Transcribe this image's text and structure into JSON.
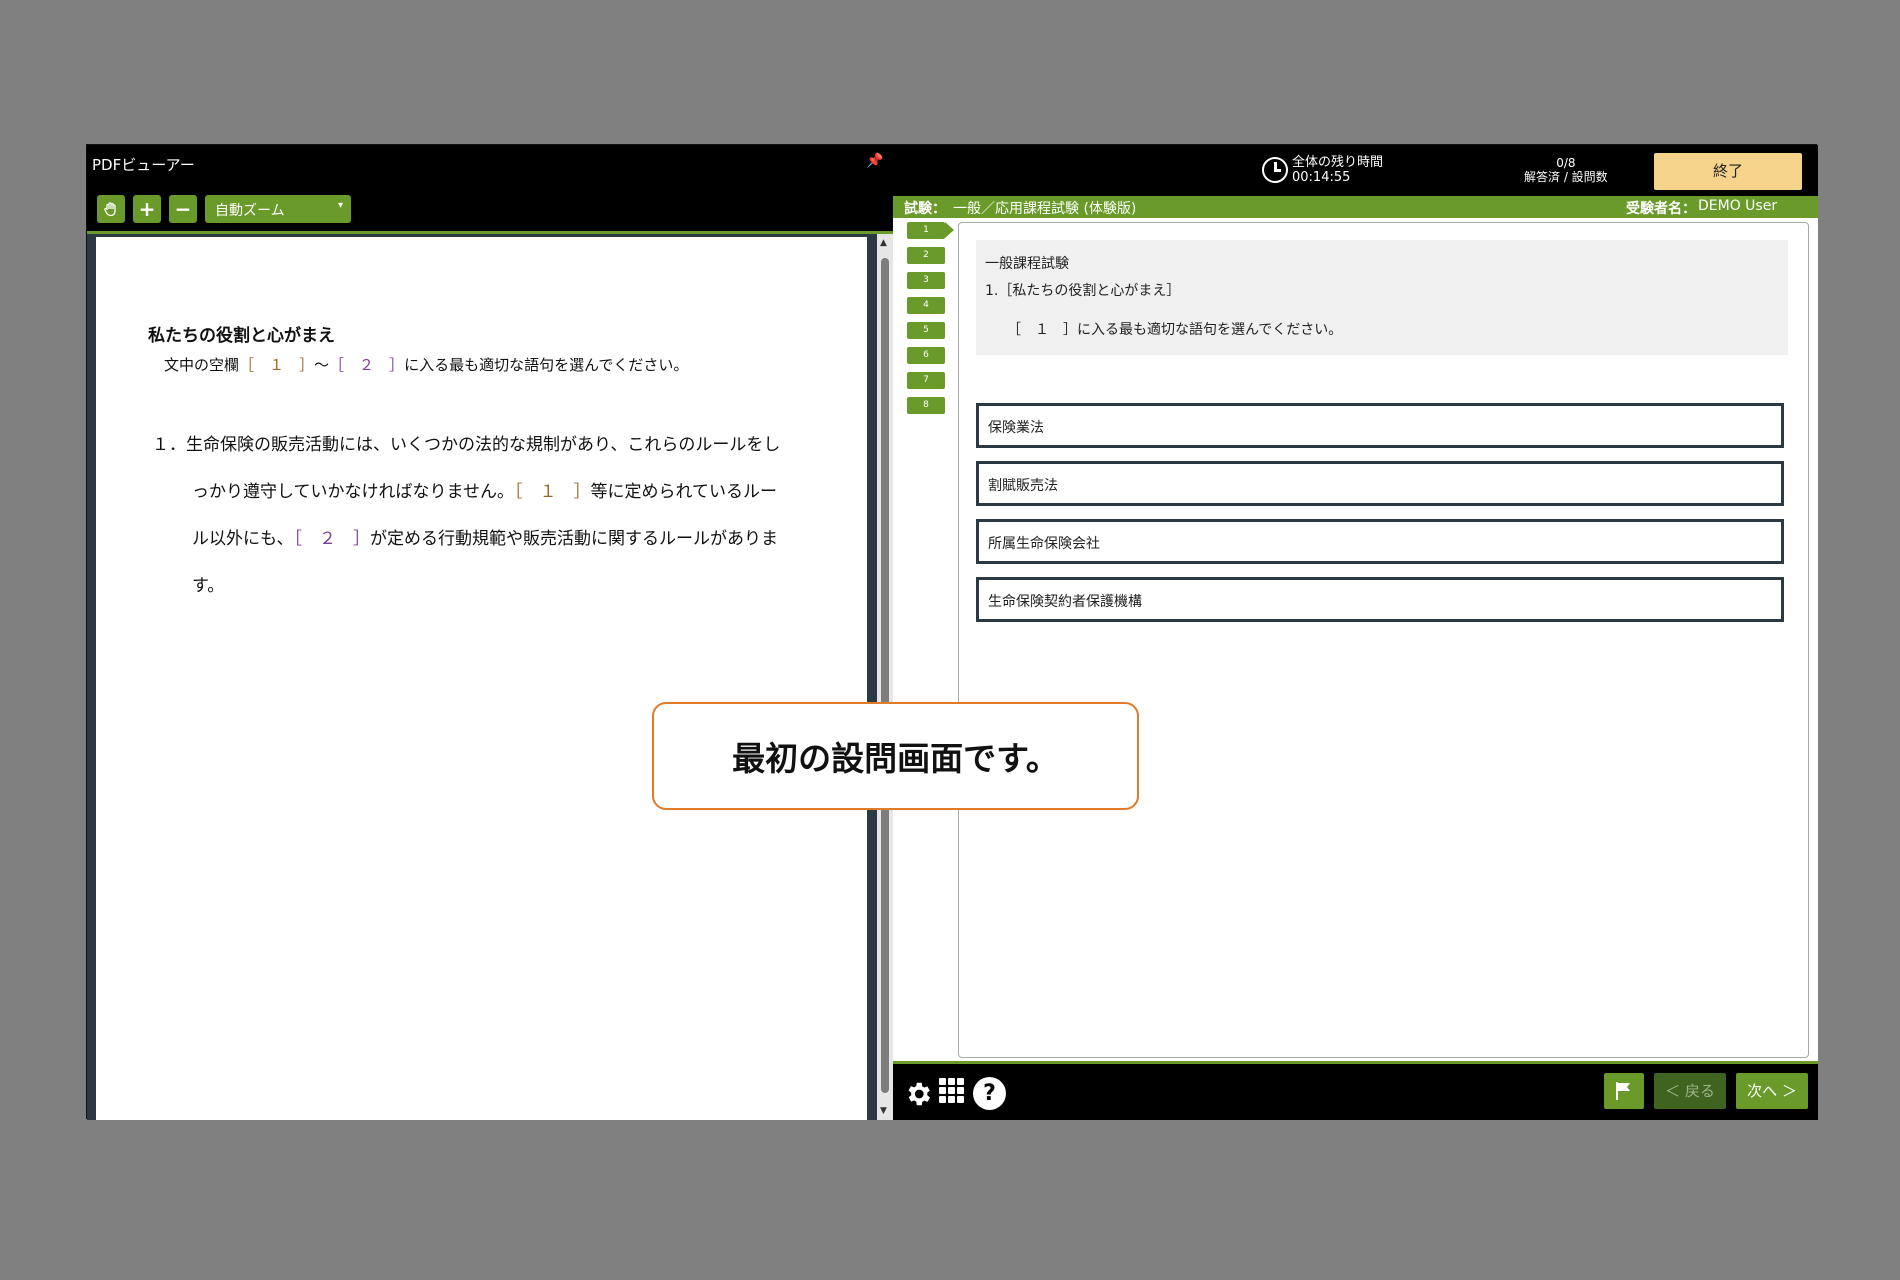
{
  "pdf_viewer": {
    "title": "PDFビューアー",
    "pin": "📌",
    "zoom": "自動ズーム",
    "doc": {
      "heading": "私たちの役割と心がまえ",
      "instr_pre": "文中の空欄",
      "instr_b1": "［　１　］",
      "instr_mid": "～",
      "instr_b2": "［　２　］",
      "instr_post": "に入る最も適切な語句を選んでください。",
      "num": "１．",
      "line1": "生命保険の販売活動には、いくつかの法的な規制があり、これらのルールをし",
      "line2_pre": "っかり遵守していかなければなりません。",
      "line2_blank": "［　１　］",
      "line2_post": "等に定められているルー",
      "line3_pre": "ル以外にも、",
      "line3_blank": "［　２　］",
      "line3_post": "が定める行動規範や販売活動に関するルールがありま",
      "line4": "す。"
    }
  },
  "exam": {
    "timer_label": "全体の残り時間",
    "timer_value": "00:14:55",
    "progress_count": "0/8",
    "progress_label": "解答済 / 設問数",
    "end_label": "終了",
    "exam_label": "試験：",
    "exam_name": "一般／応用課程試験 (体験版)",
    "user_label": "受験者名：",
    "user_name": "DEMO User",
    "question_numbers": [
      "1",
      "2",
      "3",
      "4",
      "5",
      "6",
      "7",
      "8"
    ],
    "question": {
      "section": "一般課程試験",
      "title": "1.［私たちの役割と心がまえ］",
      "prompt": "［　１　］に入る最も適切な語句を選んでください。"
    },
    "options": [
      "保険業法",
      "割賦販売法",
      "所属生命保険会社",
      "生命保険契約者保護機構"
    ],
    "back_label": "＜ 戻る",
    "next_label": "次へ ＞"
  },
  "callout": "最初の設問画面です。",
  "colors": {
    "accent": "#6a9a2a",
    "end_button": "#f5d38a",
    "callout_border": "#e07b2a"
  }
}
